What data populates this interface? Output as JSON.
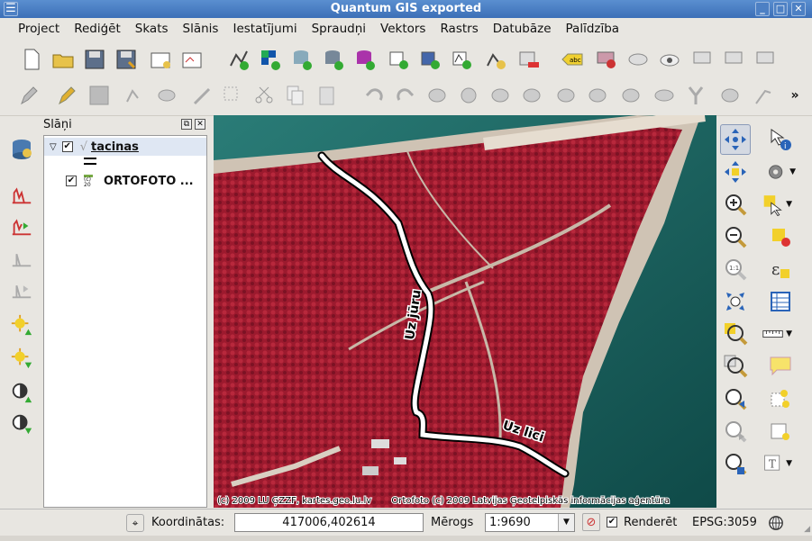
{
  "window": {
    "title": "Quantum GIS exported"
  },
  "menubar": {
    "items": [
      "Project",
      "Rediģēt",
      "Skats",
      "Slānis",
      "Iestatījumi",
      "Spraudņi",
      "Vektors",
      "Rastrs",
      "Datubāze",
      "Palīdzība"
    ]
  },
  "layers_panel": {
    "title": "Slāņi",
    "layers": [
      {
        "name": "tacinas",
        "checked": true,
        "type": "vector"
      },
      {
        "name": "ORTOFOTO ...",
        "checked": true,
        "type": "raster",
        "thumb_text": "(c) 20"
      }
    ]
  },
  "map": {
    "labels": {
      "road1": "Uz jūru",
      "road2": "Uz lici"
    },
    "attribution": "(c) 2009 LU ĢZZF, kartes.geo.lu.lv       Ortofoto (c) 2009 Latvijas Ģeotelpiskās informācijas aģentūra",
    "colors": {
      "forest": "#a01830",
      "sea": "#1e6a66",
      "sand": "#d8d0c0",
      "road": "#ffffff"
    }
  },
  "statusbar": {
    "coord_label": "Koordinātas:",
    "coord_value": "417006,402614",
    "scale_label": "Mērogs",
    "scale_value": "1:9690",
    "render_label": "Renderēt",
    "render_checked": true,
    "crs": "EPSG:3059"
  }
}
